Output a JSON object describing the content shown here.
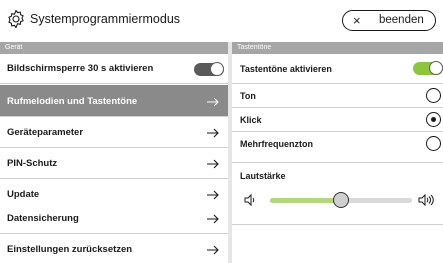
{
  "header": {
    "title": "Systemprogrammiermodus",
    "exit_icon": "×",
    "exit_label": "beenden"
  },
  "left": {
    "section": "Gerät",
    "items": [
      {
        "label": "Bildschirmsperre 30 s aktivieren",
        "control": "toggle",
        "on": false
      },
      {
        "label": "Rufmelodien und Tastentöne",
        "control": "chevron",
        "active": true
      },
      {
        "label": "Geräteparameter",
        "control": "chevron"
      },
      {
        "label": "PIN-Schutz",
        "control": "chevron"
      },
      {
        "label": "Update",
        "control": "chevron"
      },
      {
        "label": "Datensicherung",
        "control": "chevron"
      },
      {
        "label": "Einstellungen zurücksetzen",
        "control": "chevron"
      }
    ]
  },
  "right": {
    "section": "Tastentöne",
    "keytones_enabled": {
      "label": "Tastentöne aktivieren",
      "on": true
    },
    "tone_options": [
      {
        "label": "Ton",
        "selected": false
      },
      {
        "label": "Klick",
        "selected": true
      },
      {
        "label": "Mehrfrequenzton",
        "selected": false
      }
    ],
    "volume": {
      "label": "Lautstärke",
      "level": 0.5
    }
  },
  "colors": {
    "accent_green": "#8cc63f",
    "active_row": "#8a8a8a",
    "section_header": "#a6a6a6",
    "toggle_off": "#5a5a5a"
  },
  "icons": {
    "settings": "gear-icon",
    "exit": "close-icon",
    "nav": "chevron-right-icon",
    "volume_low": "speaker-low-icon",
    "volume_high": "speaker-high-icon"
  }
}
